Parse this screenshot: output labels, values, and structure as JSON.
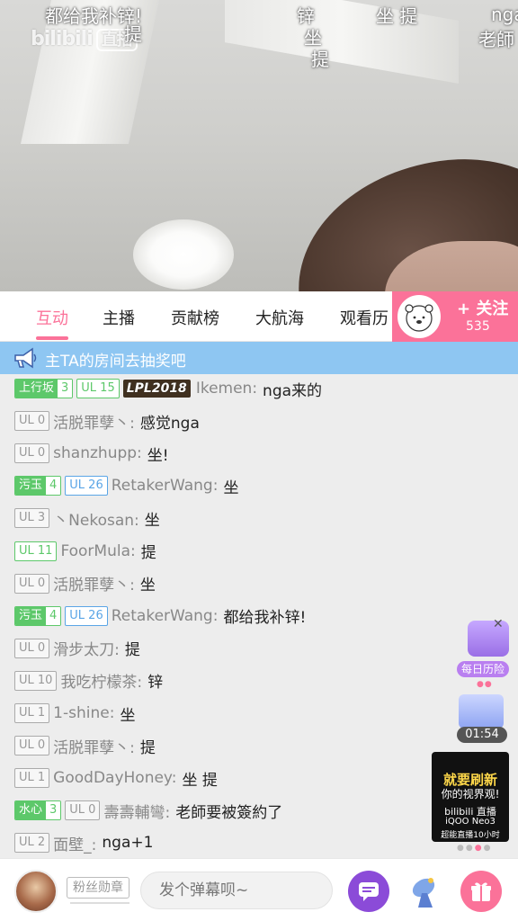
{
  "video": {
    "logo": {
      "brand": "bilibili",
      "live": "直播"
    },
    "danmaku": [
      {
        "text": "都给我补锌!"
      },
      {
        "text": "提"
      },
      {
        "text": "锌"
      },
      {
        "text": "坐"
      },
      {
        "text": "提"
      },
      {
        "text": "坐 提"
      },
      {
        "text": "nga"
      },
      {
        "text": "老師"
      }
    ]
  },
  "tabs": {
    "items": [
      {
        "label": "互动"
      },
      {
        "label": "主播"
      },
      {
        "label": "贡献榜"
      },
      {
        "label": "大航海"
      },
      {
        "label": "观看历"
      }
    ],
    "active_index": 0,
    "follow": {
      "label": "+ 关注",
      "count": "535"
    }
  },
  "notice": {
    "text": "主TA的房间去抽奖吧"
  },
  "chat": [
    {
      "medal": {
        "name": "上行坂",
        "level": "3",
        "color": "#5dc86a"
      },
      "ul": "UL 15",
      "ul_color": "#5dc86a",
      "lpl": "LPL2018",
      "user": "Ikemen:",
      "text": "nga来的"
    },
    {
      "ul": "UL 0",
      "user": "活脱罪孽丶:",
      "text": "感觉nga"
    },
    {
      "ul": "UL 0",
      "user": "shanzhupp:",
      "text": "坐!"
    },
    {
      "medal": {
        "name": "污玉",
        "level": "4",
        "color": "#5dc86a"
      },
      "ul": "UL 26",
      "ul_color": "#5aa5e6",
      "user": "RetakerWang:",
      "text": "坐"
    },
    {
      "ul": "UL 3",
      "user": "丶Nekosan:",
      "text": "坐"
    },
    {
      "ul": "UL 11",
      "ul_color": "#5dc86a",
      "user": "FoorMula:",
      "text": "提"
    },
    {
      "ul": "UL 0",
      "user": "活脱罪孽丶:",
      "text": "坐"
    },
    {
      "medal": {
        "name": "污玉",
        "level": "4",
        "color": "#5dc86a"
      },
      "ul": "UL 26",
      "ul_color": "#5aa5e6",
      "user": "RetakerWang:",
      "text": "都给我补锌!"
    },
    {
      "ul": "UL 0",
      "user": "滑步太刀:",
      "text": "提"
    },
    {
      "ul": "UL 10",
      "user": "我吃柠檬茶:",
      "text": "锌"
    },
    {
      "ul": "UL 1",
      "user": "1-shine:",
      "text": "坐"
    },
    {
      "ul": "UL 0",
      "user": "活脱罪孽丶:",
      "text": "提"
    },
    {
      "ul": "UL 1",
      "user": "GoodDayHoney:",
      "text": "坐 提"
    },
    {
      "medal": {
        "name": "水心",
        "level": "3",
        "color": "#5dc86a"
      },
      "ul": "UL 0",
      "user": "壽壽輔彎:",
      "text": "老師要被簽約了"
    },
    {
      "ul": "UL 2",
      "user": "面壁_:",
      "text": "nga+1"
    }
  ],
  "widgets": {
    "daily_label": "每日历险",
    "timer": "01:54",
    "ad_lines": [
      "就要刷新",
      "你的视界观!",
      "bilibili 直播",
      "iQOO Neo3",
      "超能直播10小时"
    ]
  },
  "bottom": {
    "fan_badge": "粉丝勋章",
    "input_placeholder": "发个弹幕呗~"
  },
  "colors": {
    "accent": "#fb7299",
    "notice_bg": "#8ec6f2",
    "chat_button": "#8b4bd8"
  }
}
